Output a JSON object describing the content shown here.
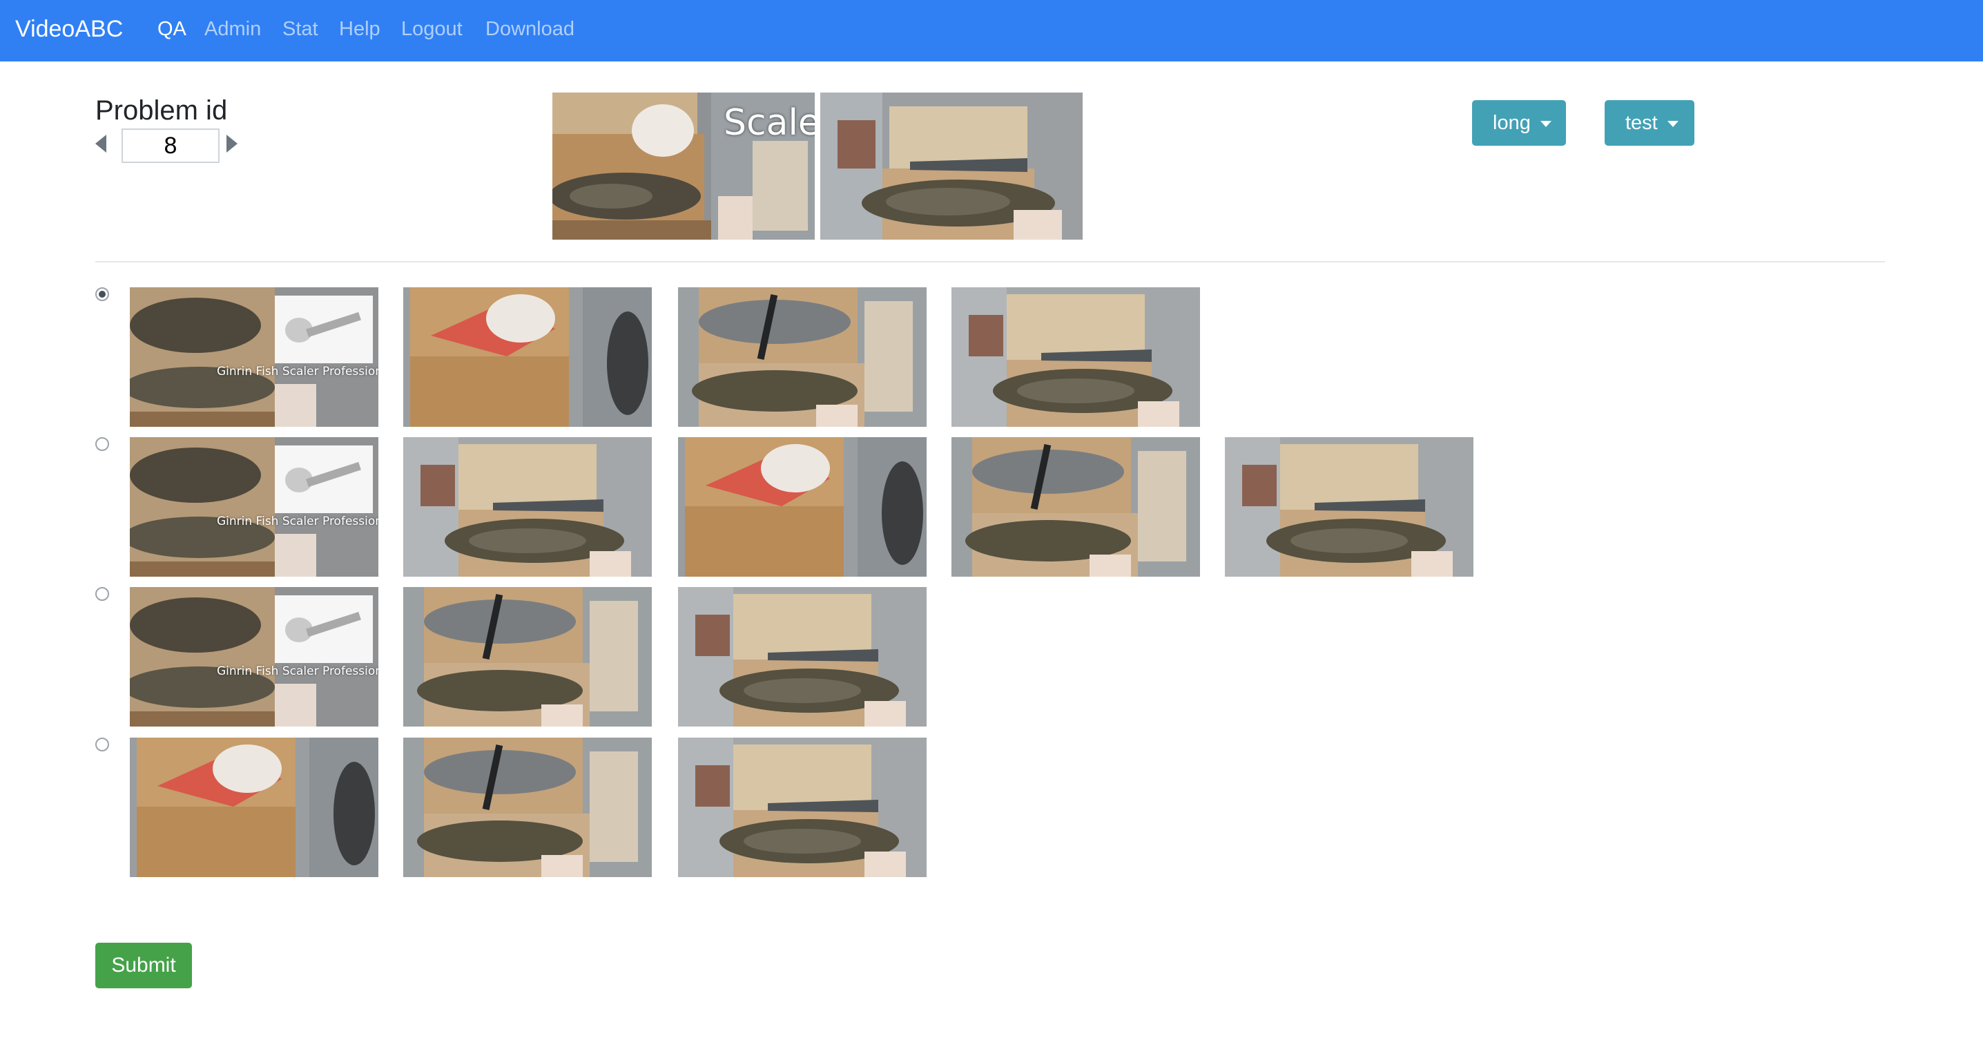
{
  "navbar": {
    "brand": "VideoABC",
    "items": [
      {
        "label": "QA",
        "active": true
      },
      {
        "label": "Admin"
      },
      {
        "label": "Stat"
      },
      {
        "label": "Help"
      },
      {
        "label": "Logout"
      },
      {
        "label": "Download"
      }
    ],
    "background_color": "#3080f4"
  },
  "problem": {
    "title": "Problem id",
    "id_value": "8"
  },
  "question": {
    "frame_caption": "Scale"
  },
  "dropdowns": {
    "length": "long",
    "split": "test"
  },
  "options": {
    "selected_index": 0,
    "scaler_caption": "Ginrin Fish Scaler Professional",
    "rows": [
      {
        "frames": [
          "scaler-ad",
          "cut-red-fish",
          "knife-on-fish",
          "fish-on-board"
        ]
      },
      {
        "frames": [
          "scaler-ad",
          "fish-on-board",
          "cut-red-fish",
          "knife-on-fish",
          "fish-on-board"
        ]
      },
      {
        "frames": [
          "scaler-ad",
          "knife-on-fish",
          "fish-on-board"
        ]
      },
      {
        "frames": [
          "cut-red-fish",
          "knife-on-fish",
          "fish-on-board"
        ]
      }
    ]
  },
  "actions": {
    "submit_label": "Submit"
  },
  "colors": {
    "dropdown": "#43a1b6",
    "submit": "#45a249"
  }
}
